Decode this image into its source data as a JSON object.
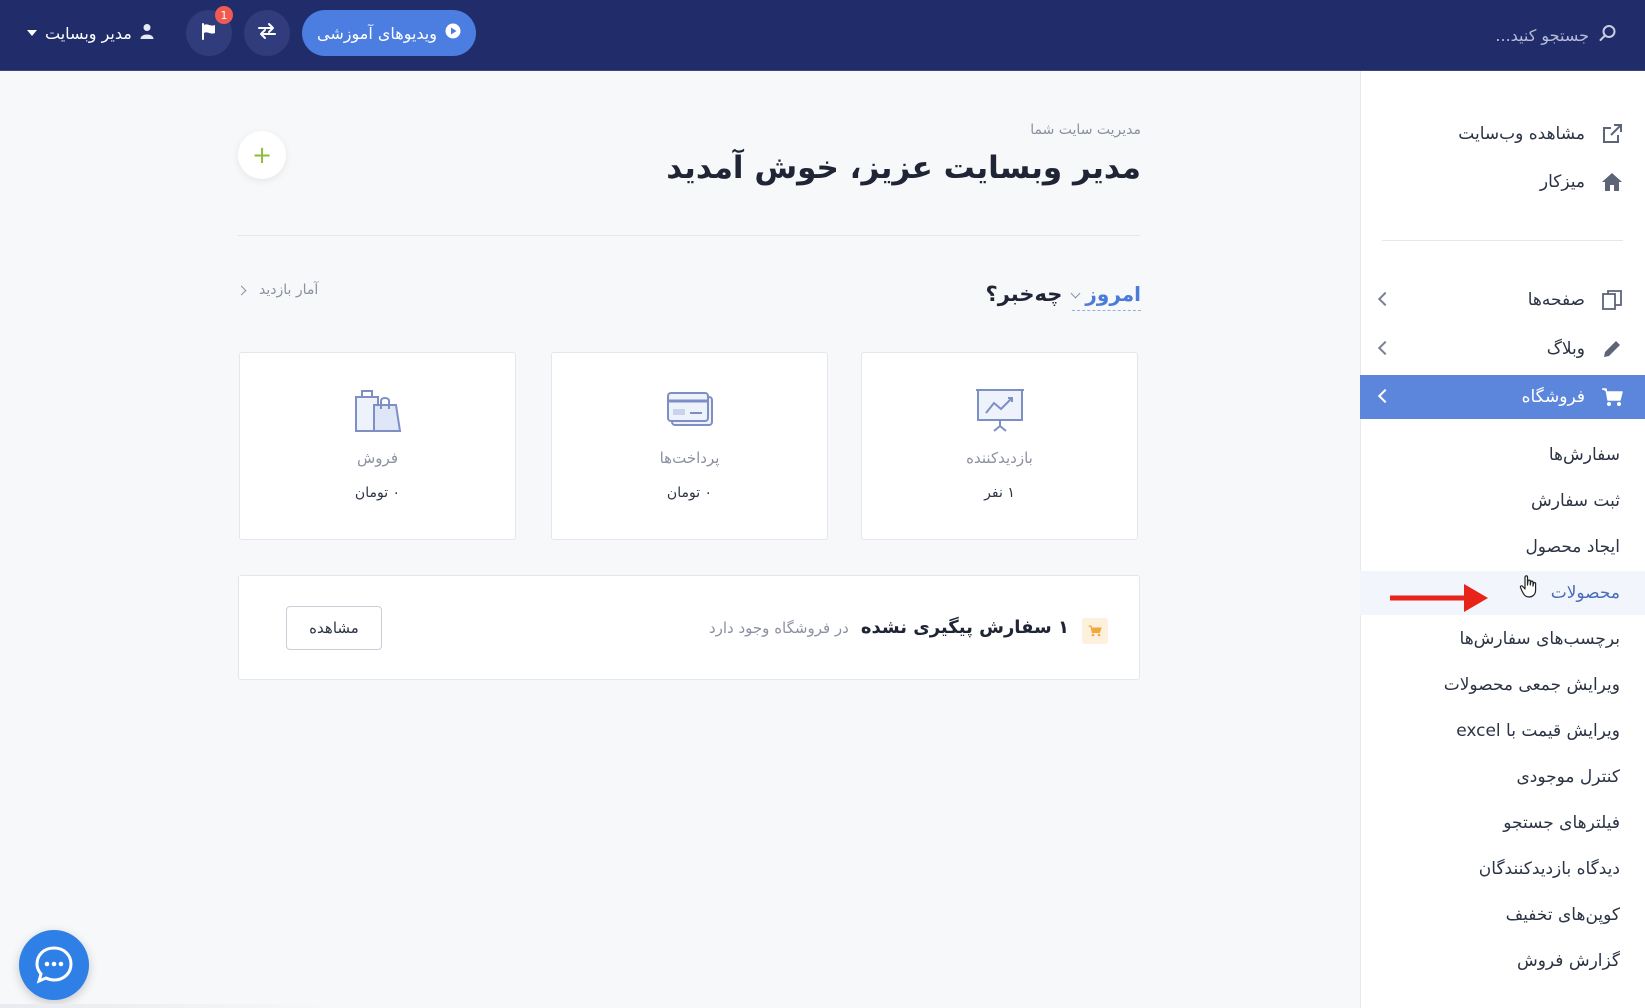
{
  "topbar": {
    "search_placeholder": "جستجو کنید...",
    "videos_label": "ویدیوهای آموزشی",
    "notif_count": "1",
    "user_label": "مدیر وبسایت"
  },
  "sidebar": {
    "view_site": "مشاهده وب‌سایت",
    "dashboard": "میزکار",
    "pages": "صفحه‌ها",
    "blog": "وبلاگ",
    "shop": "فروشگاه",
    "sub_items": [
      "سفارش‌ها",
      "ثبت سفارش",
      "ایجاد محصول",
      "محصولات",
      "برچسب‌های سفارش‌ها",
      "ویرایش جمعی محصولات",
      "ویرایش قیمت با excel",
      "کنترل موجودی",
      "فیلترهای جستجو",
      "دیدگاه بازدیدکنندگان",
      "کوپن‌های تخفیف",
      "گزارش فروش"
    ]
  },
  "main": {
    "subtitle": "مدیریت سایت شما",
    "title": "مدیر وبسایت عزیز، خوش آمدید",
    "add_label": "+",
    "period": "امروز",
    "question": "چه‌خبر؟",
    "visit_stats": "آمار بازدید",
    "cards": [
      {
        "label": "بازدیدکننده",
        "value": "۱ نفر"
      },
      {
        "label": "پرداخت‌ها",
        "value": "۰ تومان"
      },
      {
        "label": "فروش",
        "value": "۰ تومان"
      }
    ],
    "orders": {
      "strong": "۱ سفارش پیگیری نشده",
      "light": "در فروشگاه وجود دارد",
      "view": "مشاهده"
    }
  },
  "colors": {
    "topbar": "#212d6b",
    "accent": "#5b86db",
    "button": "#4b7ee0",
    "badge": "#f05a50",
    "arrow": "#e8231a"
  }
}
